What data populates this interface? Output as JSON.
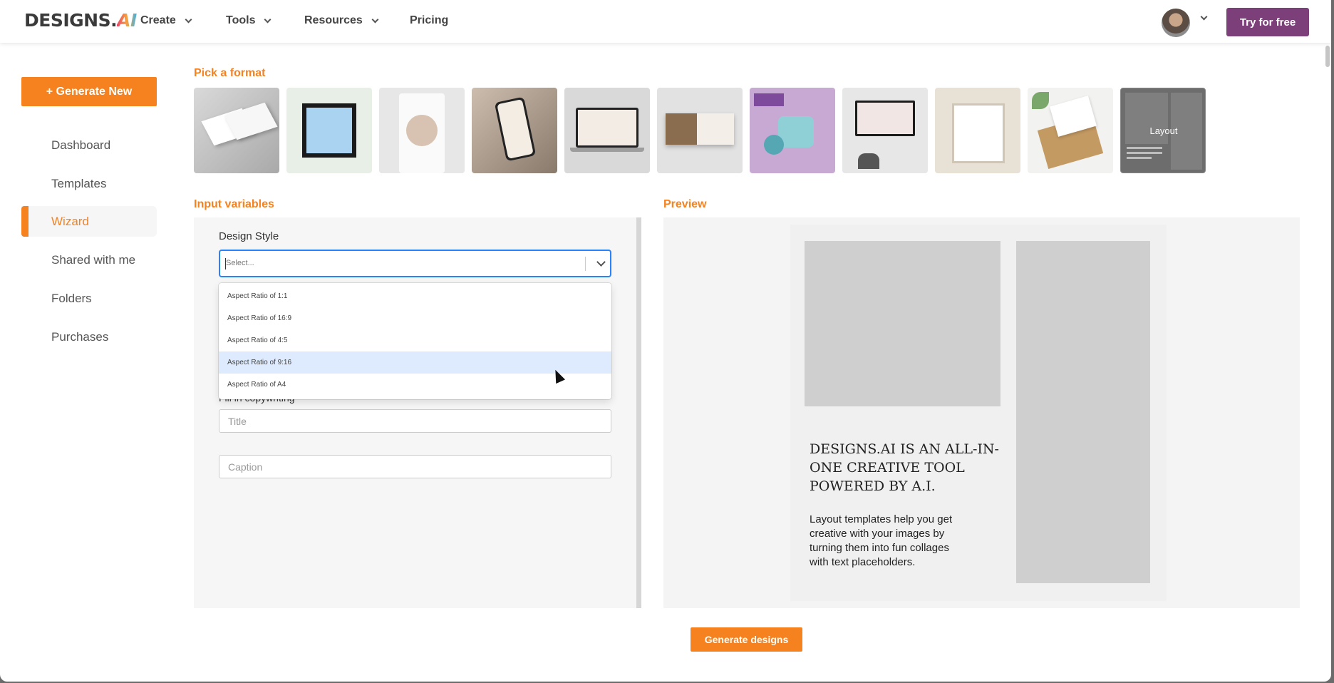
{
  "header": {
    "logo_text": "DESIGNS.",
    "logo_ai": "AI",
    "nav": [
      {
        "label": "Create"
      },
      {
        "label": "Tools"
      },
      {
        "label": "Resources"
      },
      {
        "label": "Pricing"
      }
    ],
    "cta_label": "Try for free"
  },
  "sidebar": {
    "generate_label": "+ Generate New",
    "items": [
      {
        "label": "Dashboard"
      },
      {
        "label": "Templates"
      },
      {
        "label": "Wizard",
        "active": true
      },
      {
        "label": "Shared with me"
      },
      {
        "label": "Folders"
      },
      {
        "label": "Purchases"
      }
    ]
  },
  "formats": {
    "title": "Pick a format",
    "layout_label": "Layout"
  },
  "inputs": {
    "title": "Input variables",
    "design_style_label": "Design Style",
    "select_placeholder": "Select...",
    "options": [
      {
        "label": "Aspect Ratio of 1:1"
      },
      {
        "label": "Aspect Ratio of 16:9"
      },
      {
        "label": "Aspect Ratio of 4:5"
      },
      {
        "label": "Aspect Ratio of 9:16",
        "highlighted": true
      },
      {
        "label": "Aspect Ratio of A4"
      }
    ],
    "partial_label": "Fill in copywriting",
    "title_placeholder": "Title",
    "caption_placeholder": "Caption"
  },
  "preview": {
    "title": "Preview",
    "headline": "DESIGNS.AI IS AN ALL-IN-ONE CREATIVE TOOL POWERED BY A.I.",
    "body": "Layout templates help you get creative with your images by turning them into fun collages with text placeholders."
  },
  "actions": {
    "generate_designs": "Generate designs"
  },
  "colors": {
    "accent": "#f5821f",
    "cta": "#7c3f7a",
    "select_focus": "#2684ff",
    "option_highlight": "#deebff"
  }
}
